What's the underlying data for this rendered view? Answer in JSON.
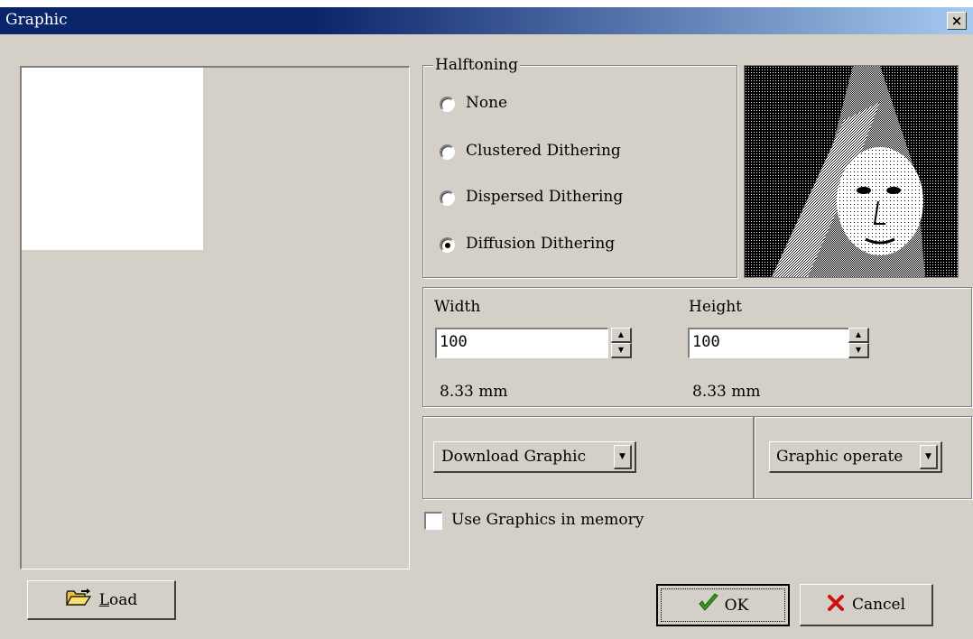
{
  "window": {
    "title": "Graphic",
    "close_label": "×"
  },
  "halftoning": {
    "legend": "Halftoning",
    "options": [
      {
        "label": "None",
        "selected": false
      },
      {
        "label": "Clustered Dithering",
        "selected": false
      },
      {
        "label": "Dispersed Dithering",
        "selected": false
      },
      {
        "label": "Diffusion Dithering",
        "selected": true
      }
    ]
  },
  "size": {
    "width_label": "Width",
    "width_value": "100",
    "width_mm": "8.33 mm",
    "height_label": "Height",
    "height_value": "100",
    "height_mm": "8.33 mm"
  },
  "actions": {
    "download_label": "Download Graphic",
    "operate_label": "Graphic operate",
    "use_memory_label": "Use Graphics in memory",
    "use_memory_checked": false,
    "load_label": "Load",
    "load_mnemonic": "L",
    "load_rest": "oad",
    "ok_label": "OK",
    "cancel_label": "Cancel"
  },
  "colors": {
    "title_start": "#0a246a",
    "title_end": "#a6caf0",
    "face": "#d4d0c8",
    "ok_check": "#3a9a1a",
    "cancel_x": "#d01010"
  },
  "icons": {
    "load": "open-folder-icon",
    "ok": "checkmark-icon",
    "cancel": "red-x-icon",
    "thumbnail": "dithered-portrait-image"
  }
}
